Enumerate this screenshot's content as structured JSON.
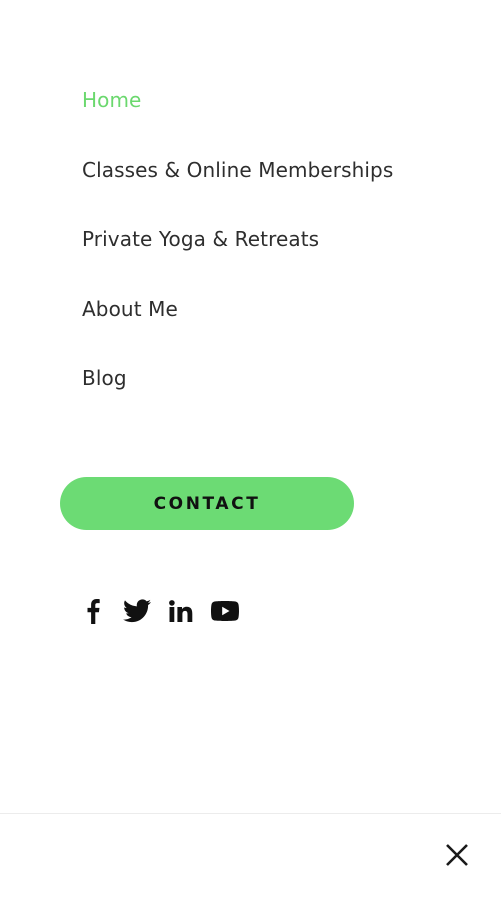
{
  "nav": {
    "items": [
      {
        "label": "Home",
        "active": true
      },
      {
        "label": "Classes & Online Memberships",
        "active": false
      },
      {
        "label": "Private Yoga & Retreats",
        "active": false
      },
      {
        "label": "About Me",
        "active": false
      },
      {
        "label": "Blog",
        "active": false
      }
    ]
  },
  "cta": {
    "label": "CONTACT"
  },
  "social": {
    "icons": [
      "facebook-icon",
      "twitter-icon",
      "linkedin-icon",
      "youtube-icon"
    ]
  },
  "close": {
    "icon": "close-icon"
  },
  "colors": {
    "accent": "#6cdb74",
    "active_link": "#6bd86e",
    "text": "#2e2e2e",
    "icon": "#111111",
    "divider": "#ececec"
  }
}
